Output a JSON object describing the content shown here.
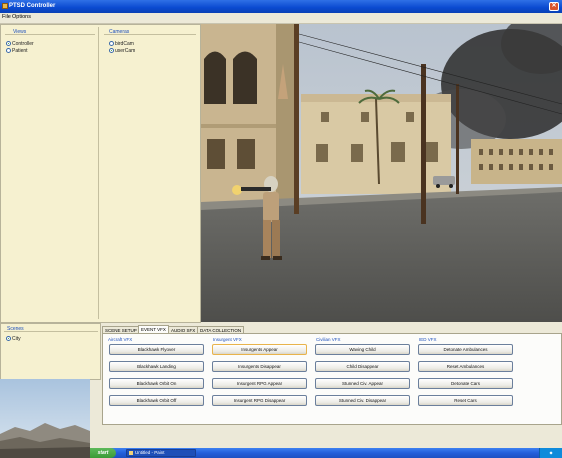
{
  "window": {
    "title": "PTSD Controller"
  },
  "menu": [
    "File",
    "Options"
  ],
  "views_panel": {
    "title": "Views",
    "options": [
      {
        "label": "Controller",
        "selected": true
      },
      {
        "label": "Patient",
        "selected": false
      }
    ]
  },
  "cameras_panel": {
    "title": "Cameras",
    "options": [
      {
        "label": "birdCam",
        "selected": false
      },
      {
        "label": "userCam",
        "selected": true
      }
    ]
  },
  "scenes_panel": {
    "title": "Scenes",
    "options": [
      {
        "label": "City",
        "selected": true
      }
    ]
  },
  "tabs": [
    "SCENE SETUP",
    "EVENT VFX",
    "AUDIO SFX",
    "DATA COLLECTION"
  ],
  "active_tab": 1,
  "columns": [
    {
      "title": "Aircraft VFX",
      "buttons": [
        "Blackhawk Flyover",
        "Blackhawk Landing",
        "Blackhawk Orbit On",
        "Blackhawk Orbit Off"
      ]
    },
    {
      "title": "Insurgent VFX",
      "buttons": [
        "Insurgents Appear",
        "Insurgents Disappear",
        "Insurgent RPG Appear",
        "Insurgent RPG Disappear"
      ]
    },
    {
      "title": "Civilian VFX",
      "buttons": [
        "Waving Child",
        "Child Disappear",
        "Stunned Civ. Appear",
        "Stunned Civ. Disappear"
      ]
    },
    {
      "title": "IED VFX",
      "buttons": [
        "Detonate Ambulances",
        "Reset Ambulances",
        "Detonate Cars",
        "Reset Cars"
      ]
    }
  ],
  "taskbar": {
    "start_label": "start",
    "task_label": "Untitled - Paint"
  },
  "icons": {
    "close": "close-icon",
    "app": "app-icon"
  },
  "colors": {
    "titlebar": "#0a4ad0",
    "panel_bg": "#f6f1d0",
    "group_title": "#1c4fbd",
    "taskbar": "#245edb"
  }
}
